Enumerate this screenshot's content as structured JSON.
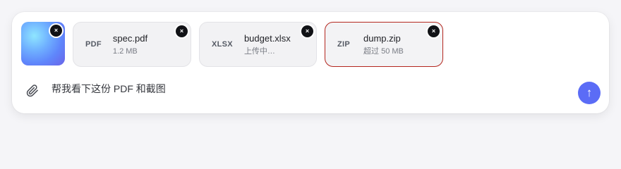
{
  "attachments": {
    "image": {
      "remove_icon": "×"
    },
    "files": [
      {
        "ext": "PDF",
        "name": "spec.pdf",
        "meta": "1.2 MB",
        "state": "ready",
        "remove_icon": "×"
      },
      {
        "ext": "XLSX",
        "name": "budget.xlsx",
        "meta": "上传中…",
        "state": "uploading",
        "remove_icon": "×"
      },
      {
        "ext": "ZIP",
        "name": "dump.zip",
        "meta": "超过 50 MB",
        "state": "error",
        "remove_icon": "×"
      }
    ]
  },
  "composer": {
    "attach_icon": "paperclip-icon",
    "message": "帮我看下这份 PDF 和截图",
    "send_icon": "↑"
  },
  "colors": {
    "accent": "#5b6cf6",
    "error": "#b3261e",
    "card_bg": "#f2f2f4"
  }
}
